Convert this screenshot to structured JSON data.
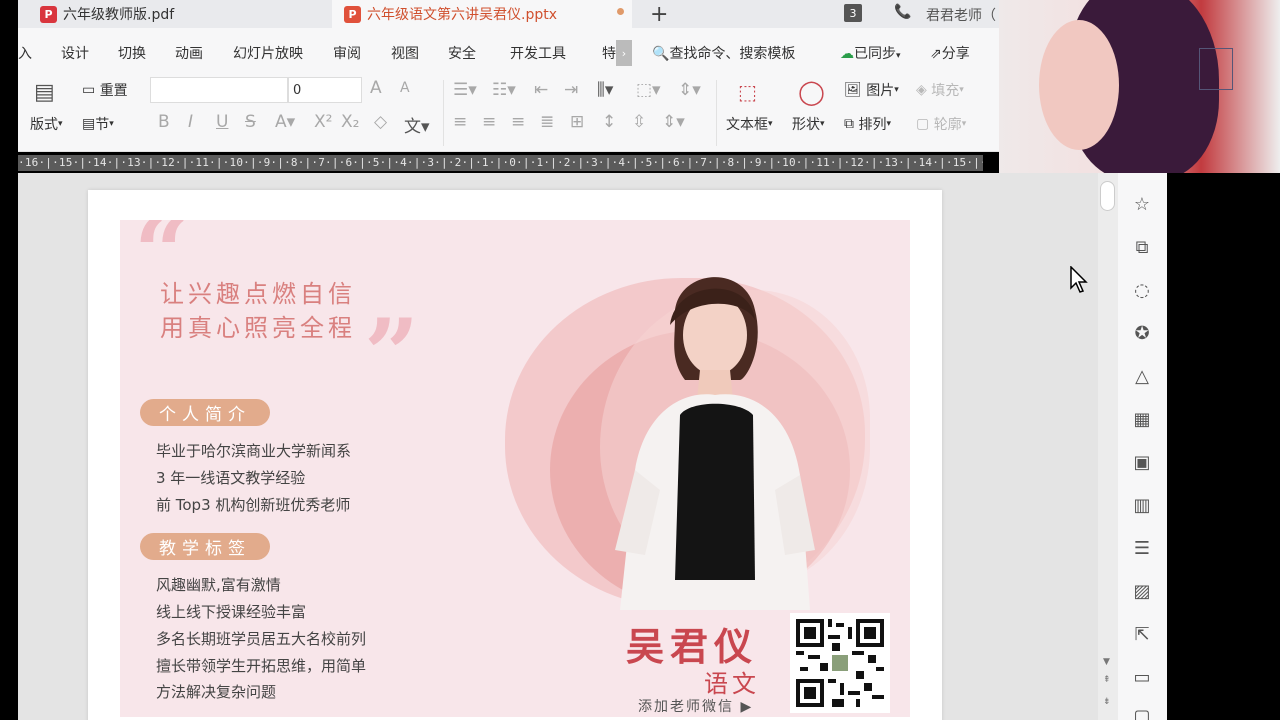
{
  "tabs": [
    {
      "label": "六年级教师版.pdf",
      "icon": "pdf-icon"
    },
    {
      "label": "六年级语文第六讲吴君仪.pptx",
      "icon": "pptx-icon"
    }
  ],
  "tab_add": "+",
  "tab_count": "3",
  "user_name": "君君老师（",
  "menu": [
    "入",
    "设计",
    "切换",
    "动画",
    "幻灯片放映",
    "审阅",
    "视图",
    "安全",
    "开发工具",
    "特"
  ],
  "menu_search": "查找命令、搜索模板",
  "menu_sync": "已同步",
  "menu_share": "分享",
  "ribbon": {
    "reset": "重置",
    "layout": "版式",
    "section": "节",
    "font_size": "0",
    "text_box": "文本框",
    "shape": "形状",
    "picture": "图片",
    "arrange": "排列",
    "fill": "填充",
    "outline": "轮廓"
  },
  "ruler": "·16·|·15·|·14·|·13·|·12·|·11·|·10·|·9·|·8·|·7·|·6·|·5·|·4·|·3·|·2·|·1·|·0·|·1·|·2·|·3·|·4·|·5·|·6·|·7·|·8·|·9·|·10·|·11·|·12·|·13·|·14·|·15·|·16·",
  "slide": {
    "slogan_line1": "让兴趣点燃自信",
    "slogan_line2": "用真心照亮全程",
    "intro_title": "个人简介",
    "intro_lines": [
      "毕业于哈尔滨商业大学新闻系",
      "3 年一线语文教学经验",
      "前 Top3 机构创新班优秀老师"
    ],
    "tags_title": "教学标签",
    "tag_lines": [
      "风趣幽默,富有激情",
      "线上线下授课经验丰富",
      "多名长期班学员居五大名校前列",
      "擅长带领学生开拓思维，用简单",
      "方法解决复杂问题"
    ],
    "teacher_name": "吴君仪",
    "subject": "语文",
    "add_wechat": "添加老师微信 ▶"
  },
  "colors": {
    "slide_bg": "#f8e6ea",
    "accent_red": "#c9474f",
    "pill": "#e2ab8c",
    "tab_active_text": "#d0502e"
  }
}
